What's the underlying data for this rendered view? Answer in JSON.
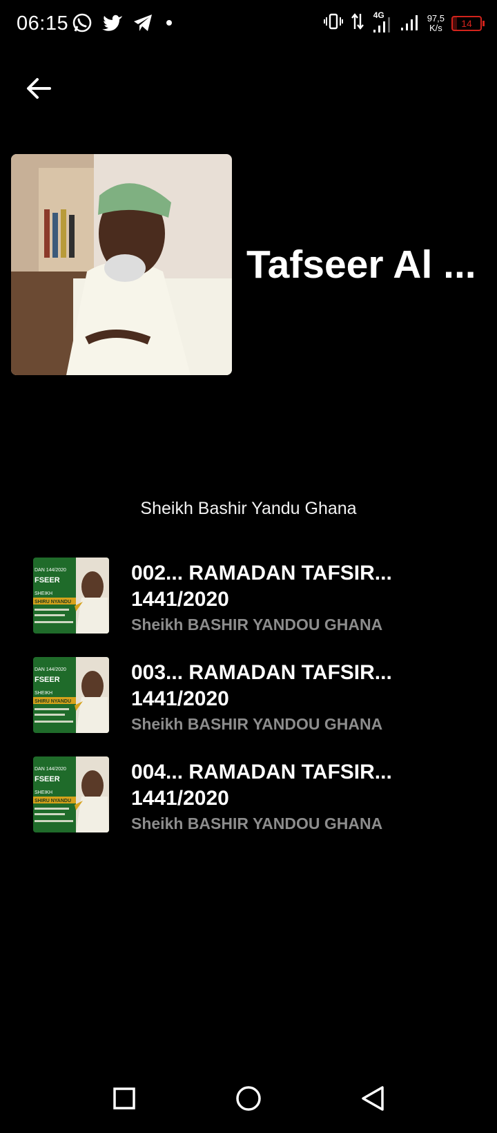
{
  "status_bar": {
    "time": "06:15",
    "left_icons": [
      "whatsapp-icon",
      "twitter-icon",
      "telegram-icon",
      "notification-dot-icon"
    ],
    "right_icons": [
      "vibrate-icon",
      "data-transfer-icon",
      "signal-4g-icon",
      "signal-icon"
    ],
    "network_label": "4G",
    "net_speed_value": "97,5",
    "net_speed_unit": "K/s",
    "battery_level": "14",
    "battery_color": "#d3231c"
  },
  "header": {
    "back_icon": "arrow-left-icon",
    "title": "Tafseer Al ...",
    "author": "Sheikh Bashir Yandu Ghana"
  },
  "tracks": [
    {
      "title_line1": "002... RAMADAN TAFSIR...",
      "title_line2": "1441/2020",
      "subtitle": "Sheikh BASHIR YANDOU GHANA"
    },
    {
      "title_line1": "003... RAMADAN TAFSIR...",
      "title_line2": "1441/2020",
      "subtitle": "Sheikh BASHIR YANDOU GHANA"
    },
    {
      "title_line1": "004... RAMADAN TAFSIR...",
      "title_line2": "1441/2020",
      "subtitle": "Sheikh BASHIR YANDOU GHANA"
    }
  ],
  "thumbnail_text": {
    "line1": "DAN 144/2020",
    "line2": "FSEER",
    "line3": "SHEIKH",
    "line4": "SHIRU NYANDU"
  },
  "nav_bar": {
    "icons": [
      "recents-square-icon",
      "home-circle-icon",
      "back-triangle-icon"
    ]
  },
  "colors": {
    "background": "#000000",
    "subtitle_gray": "#8c8c8c",
    "thumb_green": "#1f6b2a"
  }
}
